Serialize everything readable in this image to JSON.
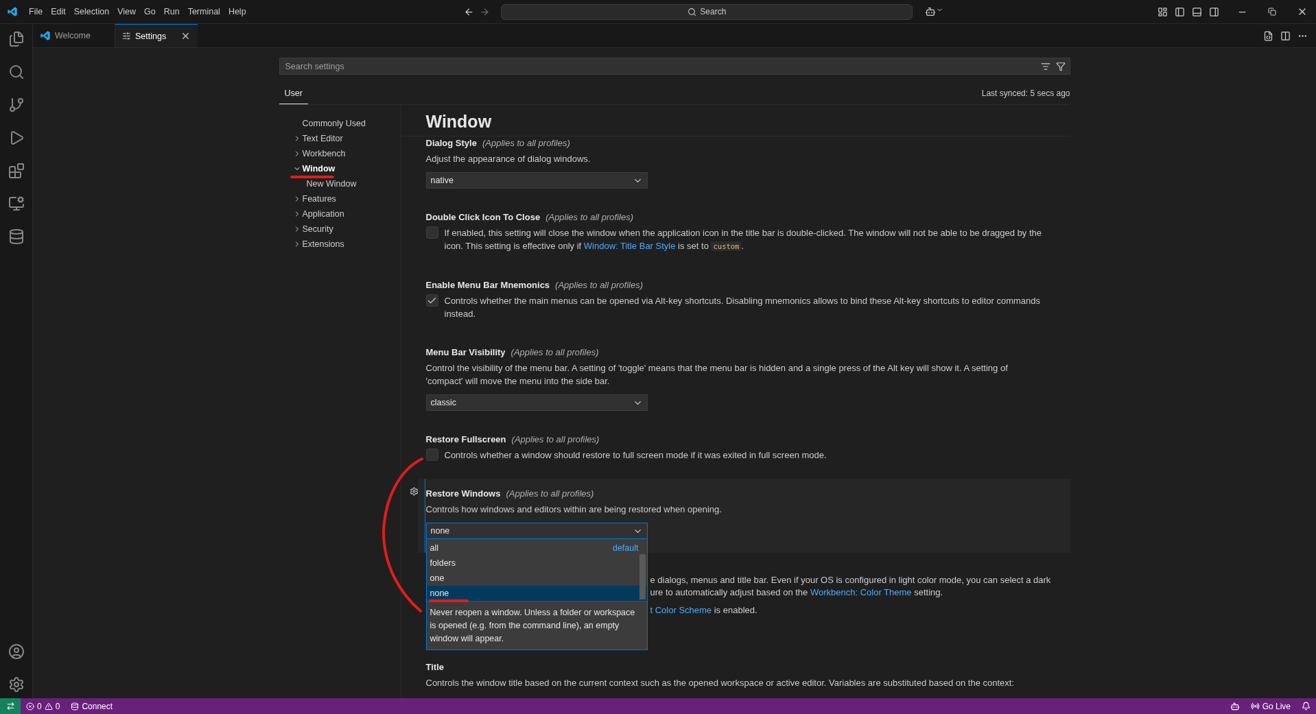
{
  "menu_bar": {
    "items": [
      "File",
      "Edit",
      "Selection",
      "View",
      "Go",
      "Run",
      "Terminal",
      "Help"
    ]
  },
  "command_center": {
    "placeholder": "Search"
  },
  "tabs": [
    {
      "label": "Welcome",
      "selected": false,
      "closable": false
    },
    {
      "label": "Settings",
      "selected": true,
      "closable": true
    }
  ],
  "settings": {
    "search": {
      "placeholder": "Search settings"
    },
    "scope_tabs": [
      {
        "label": "User",
        "selected": true
      }
    ],
    "sync_status": "Last synced: 5 secs ago",
    "toc": [
      {
        "label": "Commonly Used",
        "kind": "leaf",
        "selected": false
      },
      {
        "label": "Text Editor",
        "kind": "group",
        "expanded": false,
        "selected": false
      },
      {
        "label": "Workbench",
        "kind": "group",
        "expanded": false,
        "selected": false
      },
      {
        "label": "Window",
        "kind": "group",
        "expanded": true,
        "selected": true,
        "children": [
          {
            "label": "New Window",
            "kind": "leaf",
            "selected": false
          }
        ]
      },
      {
        "label": "Features",
        "kind": "group",
        "expanded": false,
        "selected": false
      },
      {
        "label": "Application",
        "kind": "group",
        "expanded": false,
        "selected": false
      },
      {
        "label": "Security",
        "kind": "group",
        "expanded": false,
        "selected": false
      },
      {
        "label": "Extensions",
        "kind": "group",
        "expanded": false,
        "selected": false
      }
    ],
    "section_title": "Window",
    "items": [
      {
        "kind": "select",
        "title": "Dialog Style",
        "scope": "(Applies to all profiles)",
        "description": [
          {
            "kind": "text",
            "text": "Adjust the appearance of dialog windows."
          }
        ],
        "value": "native",
        "focused": false
      },
      {
        "kind": "checkbox",
        "title": "Double Click Icon To Close",
        "scope": "(Applies to all profiles)",
        "checked": false,
        "description": [
          {
            "kind": "text",
            "text": "If enabled, this setting will close the window when the application icon in the title bar is double-clicked. The window will not be able to be dragged by the icon. This setting is effective only if "
          },
          {
            "kind": "link",
            "text": "Window: Title Bar Style"
          },
          {
            "kind": "text",
            "text": " is set to "
          },
          {
            "kind": "code",
            "text": "custom"
          },
          {
            "kind": "text",
            "text": "."
          }
        ]
      },
      {
        "kind": "checkbox",
        "title": "Enable Menu Bar Mnemonics",
        "scope": "(Applies to all profiles)",
        "checked": true,
        "description": [
          {
            "kind": "text",
            "text": "Controls whether the main menus can be opened via Alt-key shortcuts. Disabling mnemonics allows to bind these Alt-key shortcuts to editor commands instead."
          }
        ]
      },
      {
        "kind": "select",
        "title": "Menu Bar Visibility",
        "scope": "(Applies to all profiles)",
        "description": [
          {
            "kind": "text",
            "text": "Control the visibility of the menu bar. A setting of 'toggle' means that the menu bar is hidden and a single press of the Alt key will show it. A setting of 'compact' will move the menu into the side bar."
          }
        ],
        "value": "classic",
        "focused": false
      },
      {
        "kind": "checkbox",
        "title": "Restore Fullscreen",
        "scope": "(Applies to all profiles)",
        "checked": false,
        "description": [
          {
            "kind": "text",
            "text": "Controls whether a window should restore to full screen mode if it was exited in full screen mode."
          }
        ]
      },
      {
        "kind": "select",
        "title": "Restore Windows",
        "scope": "(Applies to all profiles)",
        "description": [
          {
            "kind": "text",
            "text": "Controls how windows and editors within are being restored when opening."
          }
        ],
        "value": "none",
        "focused": true,
        "dropdown": {
          "options": [
            {
              "label": "all",
              "badge": "default",
              "selected": false
            },
            {
              "label": "folders",
              "selected": false
            },
            {
              "label": "one",
              "selected": false
            },
            {
              "label": "none",
              "selected": true
            }
          ],
          "description": "Never reopen a window. Unless a folder or workspace is opened (e.g. from the command line), an empty window will appear."
        }
      },
      {
        "kind": "covered",
        "paragraphs": [
          [
            {
              "kind": "text",
              "text": "e dialogs, menus and title bar. Even if your OS is configured in light color mode, you can select a dark"
            }
          ],
          [
            {
              "kind": "text",
              "text": "ure to automatically adjust based on the "
            },
            {
              "kind": "link",
              "text": "Workbench: Color Theme"
            },
            {
              "kind": "text",
              "text": " setting."
            }
          ],
          [
            {
              "kind": "link",
              "text": "t Color Scheme"
            },
            {
              "kind": "text",
              "text": " is enabled."
            }
          ]
        ]
      },
      {
        "kind": "text",
        "title": "Title",
        "description": [
          {
            "kind": "text",
            "text": "Controls the window title based on the current context such as the opened workspace or active editor. Variables are substituted based on the context:"
          }
        ]
      }
    ]
  },
  "status_bar": {
    "errors": "0",
    "warnings": "0",
    "connect": "Connect",
    "go_live": "Go Live"
  }
}
